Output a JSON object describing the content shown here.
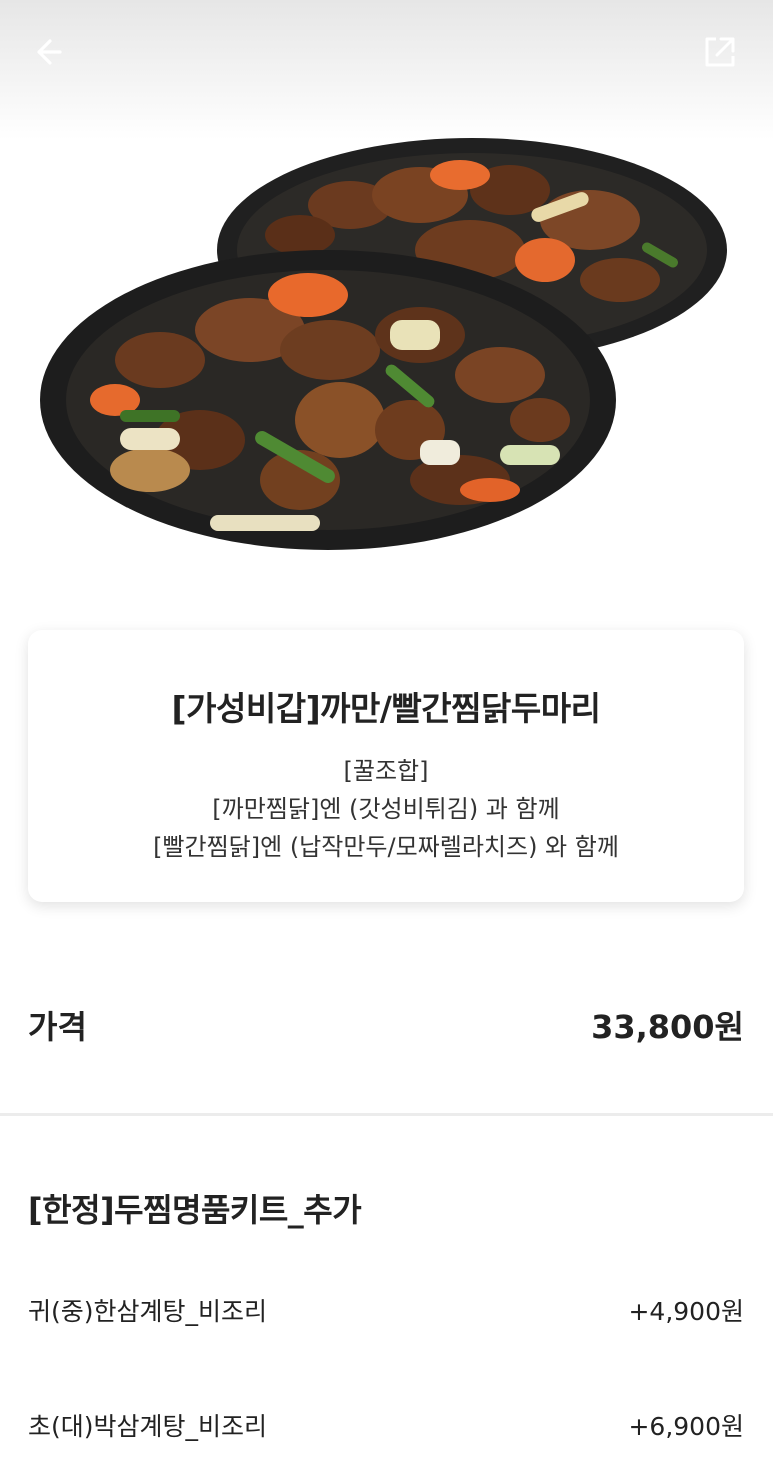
{
  "header": {
    "back_icon": "arrow-left-icon",
    "share_icon": "share-external-icon"
  },
  "product": {
    "title": "[가성비갑]까만/빨간찜닭두마리",
    "desc_lines": [
      "[꿀조합]",
      "[까만찜닭]엔 (갓성비튀김) 과  함께",
      "[빨간찜닭]엔 (납작만두/모짜렐라치즈) 와  함께"
    ]
  },
  "price": {
    "label": "가격",
    "value": "33,800원"
  },
  "options": {
    "title": "[한정]두찜명품키트_추가",
    "items": [
      {
        "name": "귀(중)한삼계탕_비조리",
        "price": "+4,900원"
      },
      {
        "name": "초(대)박삼계탕_비조리",
        "price": "+6,900원"
      }
    ]
  },
  "colors": {
    "text": "#222222",
    "divider": "#ececec",
    "plate": "#1f1f1f"
  }
}
